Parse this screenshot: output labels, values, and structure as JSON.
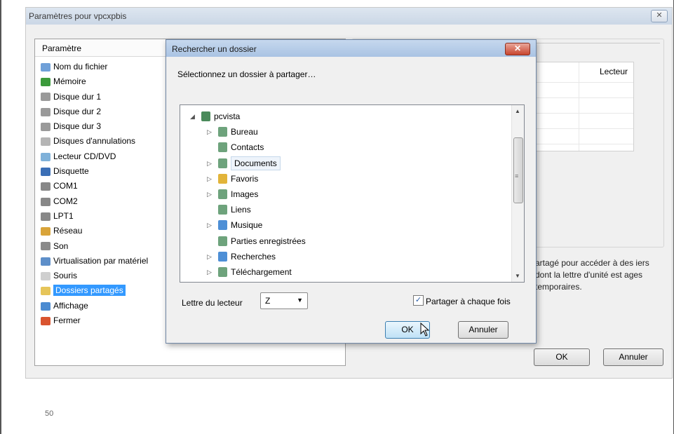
{
  "outer_dialog": {
    "title": "Paramètres pour vpcxpbis",
    "close_glyph": "✕",
    "column_header": "Paramètre",
    "items": [
      {
        "label": "Nom du fichier",
        "icon": "file-info-icon",
        "color": "#6fa0d8"
      },
      {
        "label": "Mémoire",
        "icon": "memory-icon",
        "color": "#3c9a3c"
      },
      {
        "label": "Disque dur 1",
        "icon": "hard-disk-icon",
        "color": "#9a9a9a"
      },
      {
        "label": "Disque dur 2",
        "icon": "hard-disk-icon",
        "color": "#9a9a9a"
      },
      {
        "label": "Disque dur 3",
        "icon": "hard-disk-icon",
        "color": "#9a9a9a"
      },
      {
        "label": "Disques d'annulations",
        "icon": "undo-disk-icon",
        "color": "#b5b5b5"
      },
      {
        "label": "Lecteur CD/DVD",
        "icon": "cd-dvd-icon",
        "color": "#7fb1d9"
      },
      {
        "label": "Disquette",
        "icon": "floppy-icon",
        "color": "#3b6fb6"
      },
      {
        "label": "COM1",
        "icon": "com-port-icon",
        "color": "#888888"
      },
      {
        "label": "COM2",
        "icon": "com-port-icon",
        "color": "#888888"
      },
      {
        "label": "LPT1",
        "icon": "lpt-port-icon",
        "color": "#888888"
      },
      {
        "label": "Réseau",
        "icon": "network-icon",
        "color": "#d9a43a"
      },
      {
        "label": "Son",
        "icon": "sound-icon",
        "color": "#8a8a8a"
      },
      {
        "label": "Virtualisation par matériel",
        "icon": "hardware-virtualization-icon",
        "color": "#5e8fc9"
      },
      {
        "label": "Souris",
        "icon": "mouse-icon",
        "color": "#cfcfcf"
      },
      {
        "label": "Dossiers partagés",
        "icon": "shared-folder-icon",
        "color": "#e6c55a",
        "selected": true
      },
      {
        "label": "Affichage",
        "icon": "display-icon",
        "color": "#4b8bd1"
      },
      {
        "label": "Fermer",
        "icon": "close-power-icon",
        "color": "#d9542f"
      }
    ],
    "table_header": "Lecteur",
    "description": "artagé pour accéder à des iers dont la lettre d'unité est ages temporaires.",
    "ok_label": "OK",
    "cancel_label": "Annuler"
  },
  "inner_dialog": {
    "title": "Rechercher un dossier",
    "close_glyph": "✕",
    "prompt": "Sélectionnez un dossier à partager…",
    "tree": [
      {
        "label": "pcvista",
        "icon": "computer-icon",
        "color": "#4a8a5a",
        "level": 0,
        "arrow": "◢"
      },
      {
        "label": "Bureau",
        "icon": "folder-icon",
        "color": "#6ea37c",
        "level": 1,
        "arrow": "▷"
      },
      {
        "label": "Contacts",
        "icon": "contacts-folder-icon",
        "color": "#6ea37c",
        "level": 1,
        "arrow": ""
      },
      {
        "label": "Documents",
        "icon": "documents-folder-icon",
        "color": "#6ea37c",
        "level": 1,
        "arrow": "▷",
        "highlight": true
      },
      {
        "label": "Favoris",
        "icon": "favorites-folder-icon",
        "color": "#e2b43a",
        "level": 1,
        "arrow": "▷"
      },
      {
        "label": "Images",
        "icon": "images-folder-icon",
        "color": "#6ea37c",
        "level": 1,
        "arrow": "▷"
      },
      {
        "label": "Liens",
        "icon": "links-folder-icon",
        "color": "#6ea37c",
        "level": 1,
        "arrow": ""
      },
      {
        "label": "Musique",
        "icon": "music-folder-icon",
        "color": "#4d8fd6",
        "level": 1,
        "arrow": "▷"
      },
      {
        "label": "Parties enregistrées",
        "icon": "saved-games-folder-icon",
        "color": "#6ea37c",
        "level": 1,
        "arrow": ""
      },
      {
        "label": "Recherches",
        "icon": "searches-folder-icon",
        "color": "#4d8fd6",
        "level": 1,
        "arrow": "▷"
      },
      {
        "label": "Téléchargement",
        "icon": "downloads-folder-icon",
        "color": "#6ea37c",
        "level": 1,
        "arrow": "▷"
      }
    ],
    "drive_label": "Lettre du lecteur",
    "drive_value": "Z",
    "share_label": "Partager à chaque fois",
    "share_checked": "✓",
    "ok_label": "OK",
    "cancel_label": "Annuler"
  },
  "page_number": "50"
}
